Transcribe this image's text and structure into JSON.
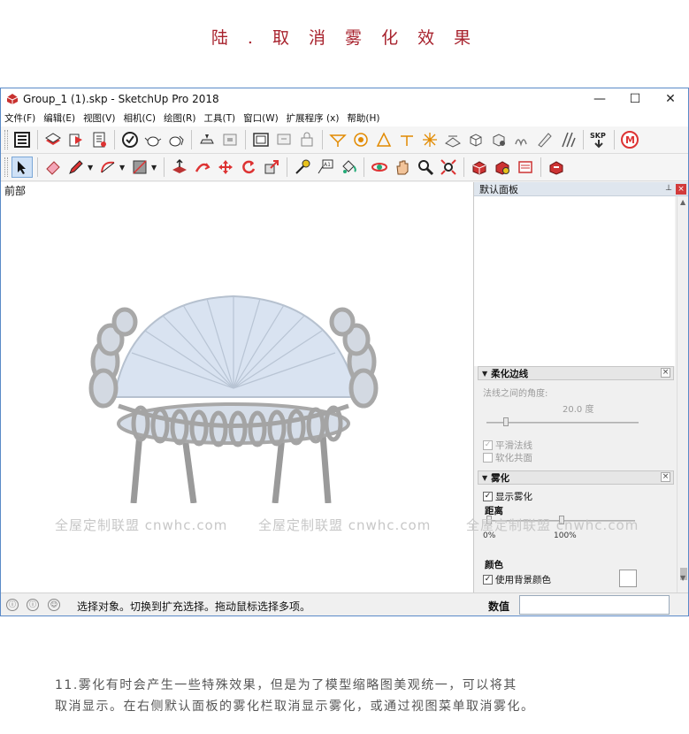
{
  "heading": "陆 . 取 消 雾 化 效 果",
  "window": {
    "title": "Group_1 (1).skp - SketchUp Pro 2018",
    "controls": {
      "minimize": "—",
      "maximize": "☐",
      "close": "✕"
    }
  },
  "menu": [
    "文件(F)",
    "编辑(E)",
    "视图(V)",
    "相机(C)",
    "绘图(R)",
    "工具(T)",
    "窗口(W)",
    "扩展程序 (x)",
    "帮助(H)"
  ],
  "viewport": {
    "scene_label": "前部"
  },
  "tray": {
    "title": "默认面板",
    "soften_panel": {
      "title": "柔化边线",
      "angle_label": "法线之间的角度:",
      "angle_value": "20.0  度",
      "smooth_normals": "平滑法线",
      "soften_coplanar": "软化共面"
    },
    "fog_panel": {
      "title": "雾化",
      "show_fog": "显示雾化",
      "distance_label": "距离",
      "pct_start": "0%",
      "pct_end": "100%",
      "color_label": "颜色",
      "use_bg_color": "使用背景颜色"
    }
  },
  "status": {
    "text": "选择对象。切换到扩充选择。拖动鼠标选择多项。",
    "vcb_label": "数值",
    "icons": [
      "ⓘ",
      "ⓘ",
      "☺"
    ]
  },
  "watermarks": [
    "全屋定制联盟 cnwhc.com",
    "全屋定制联盟 cnwhc.com",
    "全屋定制联盟 cnwhc.com"
  ],
  "caption": {
    "line1": "11.雾化有时会产生一些特殊效果，但是为了模型缩略图美观统一，可以将其",
    "line2": "取消显示。在右侧默认面板的雾化栏取消显示雾化，或通过视图菜单取消雾化。"
  },
  "colors": {
    "accent": "#a8232e",
    "window_border": "#5a8ac8",
    "tray_header": "#dfe6ee"
  }
}
